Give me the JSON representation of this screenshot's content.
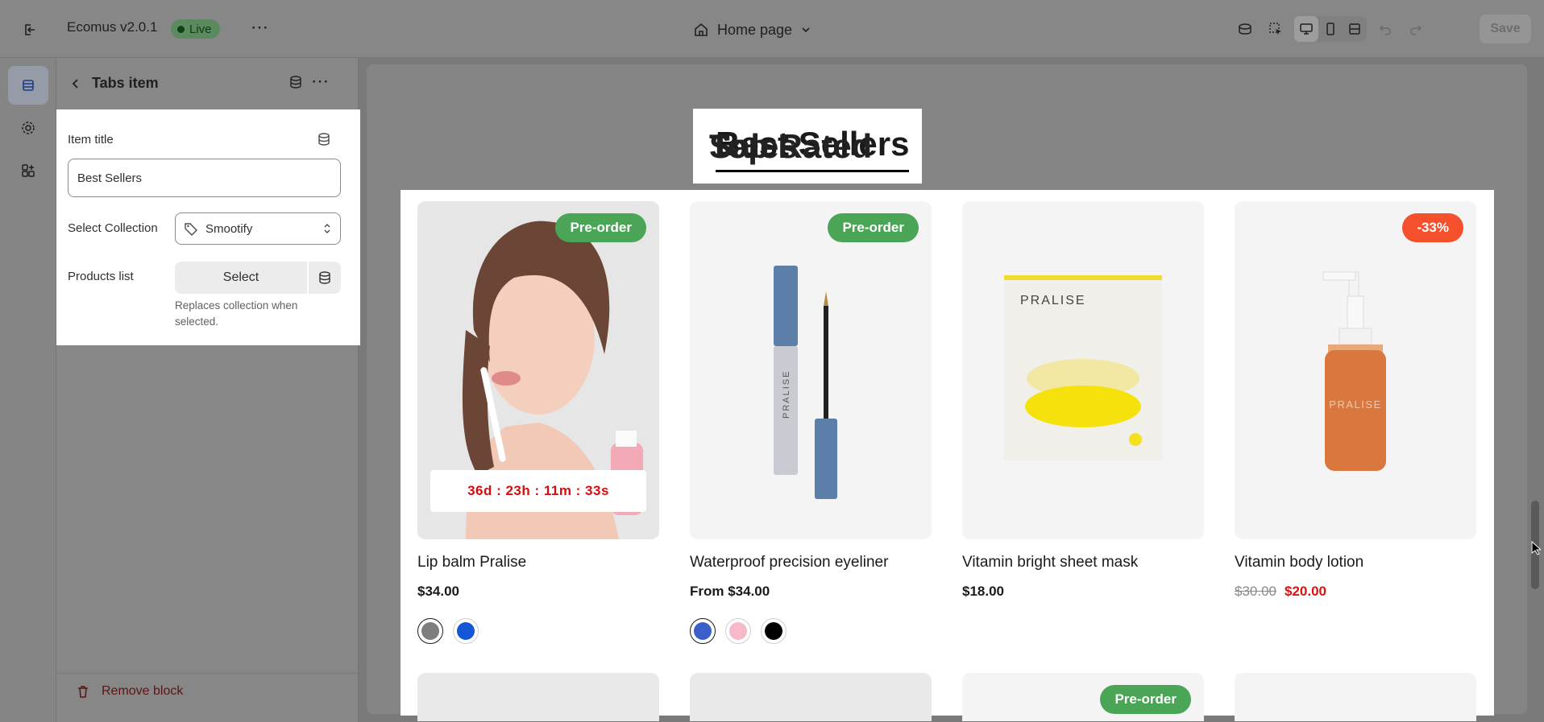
{
  "topbar": {
    "app_name": "Ecomus v2.0.1",
    "live_badge": "Live",
    "page_selector": "Home page",
    "save_label": "Save"
  },
  "sidebar": {
    "title": "Tabs item",
    "fields": {
      "item_title_label": "Item title",
      "item_title_value": "Best Sellers",
      "collection_label": "Select Collection",
      "collection_value": "Smootify",
      "products_label": "Products list",
      "products_button": "Select",
      "products_help": "Replaces collection when selected."
    },
    "remove_label": "Remove block"
  },
  "preview": {
    "tabs": [
      "Best Sellers",
      "Top Rated",
      "Sales"
    ],
    "active_tab": 0,
    "products": [
      {
        "name": "Lip balm Pralise",
        "price": "$34.00",
        "badge": "Pre-order",
        "badge_type": "preorder",
        "timer": "36d : 23h : 11m : 33s",
        "swatches": [
          "#7d7d7d",
          "#1556d6"
        ],
        "selected_swatch": 0
      },
      {
        "name": "Waterproof precision eyeliner",
        "price": "From $34.00",
        "badge": "Pre-order",
        "badge_type": "preorder",
        "swatches": [
          "#3a5fc8",
          "#f7b8c8",
          "#000000"
        ],
        "selected_swatch": 0
      },
      {
        "name": "Vitamin bright sheet mask",
        "price": "$18.00"
      },
      {
        "name": "Vitamin body lotion",
        "old_price": "$30.00",
        "price": "$20.00",
        "badge": "-33%",
        "badge_type": "sale"
      }
    ],
    "row2_badge": "Pre-order",
    "brand_text": "PRALISE"
  },
  "colors": {
    "preorder": "#4aa556",
    "sale": "#f5502c",
    "timer_text": "#d40e0e"
  }
}
